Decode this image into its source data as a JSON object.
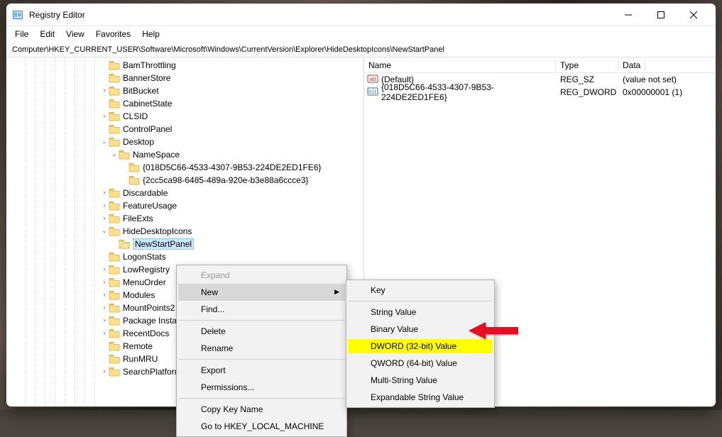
{
  "window": {
    "title": "Registry Editor"
  },
  "menubar": [
    "File",
    "Edit",
    "View",
    "Favorites",
    "Help"
  ],
  "path": "Computer\\HKEY_CURRENT_USER\\Software\\Microsoft\\Windows\\CurrentVersion\\Explorer\\HideDesktopIcons\\NewStartPanel",
  "tree": [
    {
      "indent": 8,
      "label": "BamThrottling"
    },
    {
      "indent": 8,
      "label": "BannerStore"
    },
    {
      "indent": 8,
      "label": "BitBucket",
      "exp": ">"
    },
    {
      "indent": 8,
      "label": "CabinetState"
    },
    {
      "indent": 8,
      "label": "CLSID",
      "exp": ">"
    },
    {
      "indent": 8,
      "label": "ControlPanel"
    },
    {
      "indent": 8,
      "label": "Desktop",
      "exp": "v"
    },
    {
      "indent": 9,
      "label": "NameSpace",
      "exp": "v"
    },
    {
      "indent": 10,
      "label": "{018D5C66-4533-4307-9B53-224DE2ED1FE6}"
    },
    {
      "indent": 10,
      "label": "{2cc5ca98-6485-489a-920e-b3e88a6ccce3}"
    },
    {
      "indent": 8,
      "label": "Discardable",
      "exp": ">"
    },
    {
      "indent": 8,
      "label": "FeatureUsage",
      "exp": ">"
    },
    {
      "indent": 8,
      "label": "FileExts",
      "exp": ">"
    },
    {
      "indent": 8,
      "label": "HideDesktopIcons",
      "exp": "v"
    },
    {
      "indent": 9,
      "label": "NewStartPanel",
      "selected": true,
      "open": true
    },
    {
      "indent": 8,
      "label": "LogonStats"
    },
    {
      "indent": 8,
      "label": "LowRegistry",
      "exp": ">"
    },
    {
      "indent": 8,
      "label": "MenuOrder",
      "exp": ">"
    },
    {
      "indent": 8,
      "label": "Modules",
      "exp": ">"
    },
    {
      "indent": 8,
      "label": "MountPoints2",
      "exp": ">"
    },
    {
      "indent": 8,
      "label": "Package Installation",
      "exp": ">"
    },
    {
      "indent": 8,
      "label": "RecentDocs",
      "exp": ">"
    },
    {
      "indent": 8,
      "label": "Remote"
    },
    {
      "indent": 8,
      "label": "RunMRU"
    },
    {
      "indent": 8,
      "label": "SearchPlatform",
      "exp": ">"
    }
  ],
  "val_header": {
    "name": "Name",
    "type": "Type",
    "data": "Data"
  },
  "values": [
    {
      "icon": "ab",
      "name": "(Default)",
      "type": "REG_SZ",
      "data": "(value not set)"
    },
    {
      "icon": "011",
      "name": "{018D5C66-4533-4307-9B53-224DE2ED1FE6}",
      "type": "REG_DWORD",
      "data": "0x00000001 (1)"
    }
  ],
  "context_menu": {
    "items": [
      {
        "label": "Expand",
        "disabled": true
      },
      {
        "label": "New",
        "hover": true,
        "sub": true
      },
      {
        "label": "Find..."
      },
      {
        "sep": true
      },
      {
        "label": "Delete"
      },
      {
        "label": "Rename"
      },
      {
        "sep": true
      },
      {
        "label": "Export"
      },
      {
        "label": "Permissions..."
      },
      {
        "sep": true
      },
      {
        "label": "Copy Key Name"
      },
      {
        "label": "Go to HKEY_LOCAL_MACHINE"
      }
    ]
  },
  "submenu": {
    "items": [
      {
        "label": "Key"
      },
      {
        "sep": true
      },
      {
        "label": "String Value"
      },
      {
        "label": "Binary Value"
      },
      {
        "label": "DWORD (32-bit) Value",
        "highlight": true
      },
      {
        "label": "QWORD (64-bit) Value"
      },
      {
        "label": "Multi-String Value"
      },
      {
        "label": "Expandable String Value"
      }
    ]
  }
}
